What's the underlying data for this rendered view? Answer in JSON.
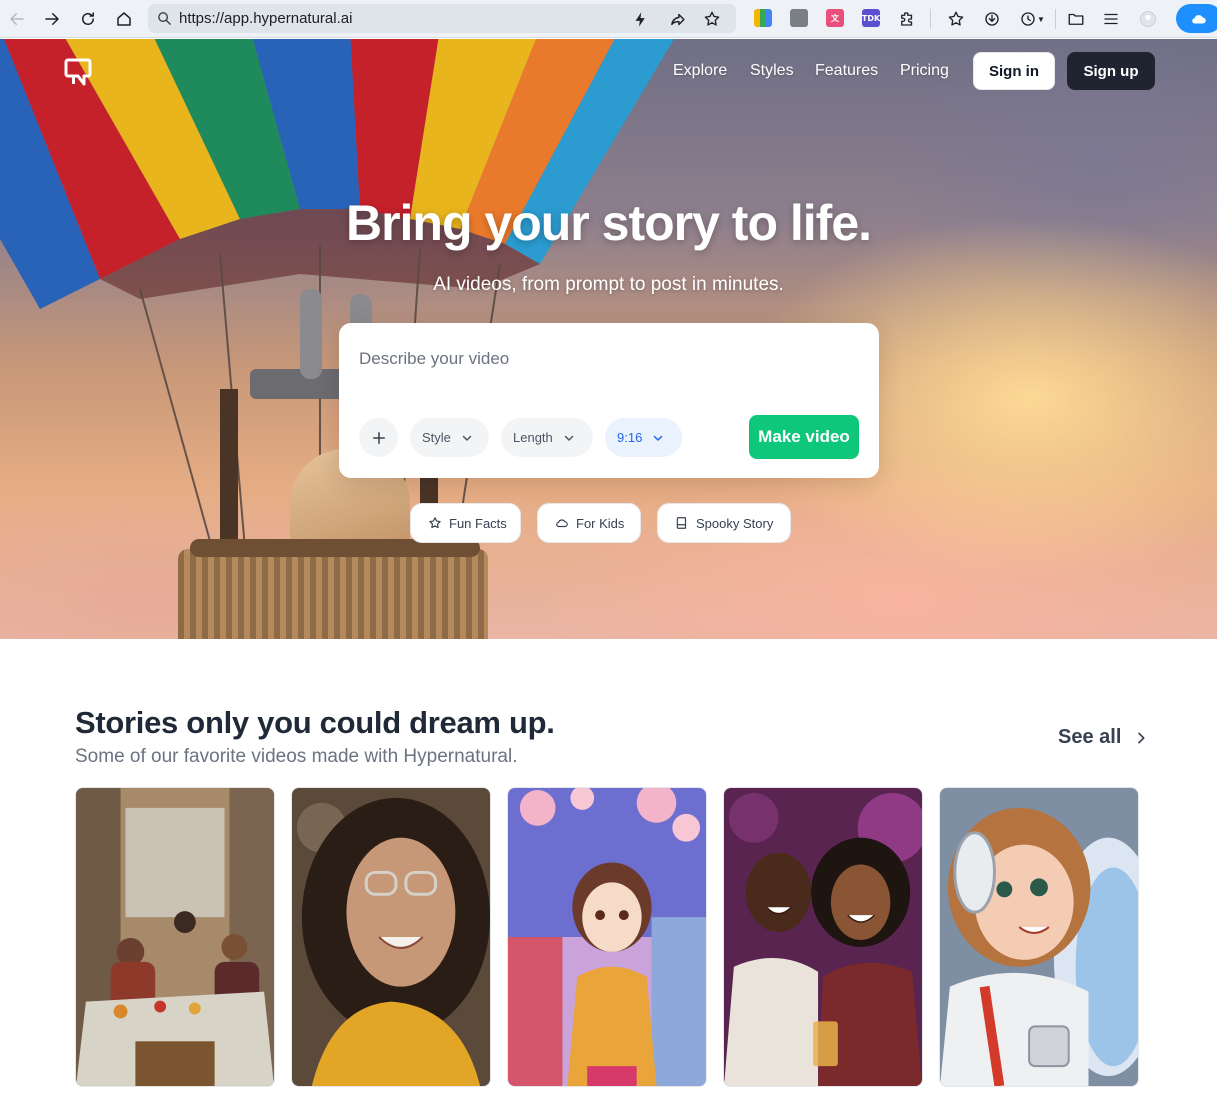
{
  "browser": {
    "url": "https://app.hypernatural.ai",
    "extensions": [
      {
        "name": "grid-extension-icon",
        "color": "#f5b400"
      },
      {
        "name": "copy-extension-icon",
        "color": "#7b7f86"
      },
      {
        "name": "translate-extension-icon",
        "color": "#e84f7a"
      },
      {
        "name": "tdk-extension-icon",
        "color": "#5a4fd1",
        "label": "TDK"
      }
    ]
  },
  "nav": {
    "links": [
      "Explore",
      "Styles",
      "Features",
      "Pricing"
    ],
    "sign_in": "Sign in",
    "sign_up": "Sign up"
  },
  "hero": {
    "title": "Bring your story to life.",
    "subtitle": "AI videos, from prompt to post in minutes.",
    "prompt_placeholder": "Describe your video",
    "controls": {
      "style": "Style",
      "length": "Length",
      "ratio": "9:16",
      "make_video": "Make video"
    },
    "chips": [
      {
        "label": "Fun Facts",
        "icon": "star-icon"
      },
      {
        "label": "For Kids",
        "icon": "cloud-icon"
      },
      {
        "label": "Spooky Story",
        "icon": "book-icon"
      }
    ]
  },
  "stories": {
    "title": "Stories only you could dream up.",
    "subtitle": "Some of our favorite videos made with Hypernatural.",
    "see_all": "See all"
  },
  "colors": {
    "accent_green": "#0ec77a",
    "dark_button": "#1f2430",
    "ratio_blue": "#2563eb"
  }
}
